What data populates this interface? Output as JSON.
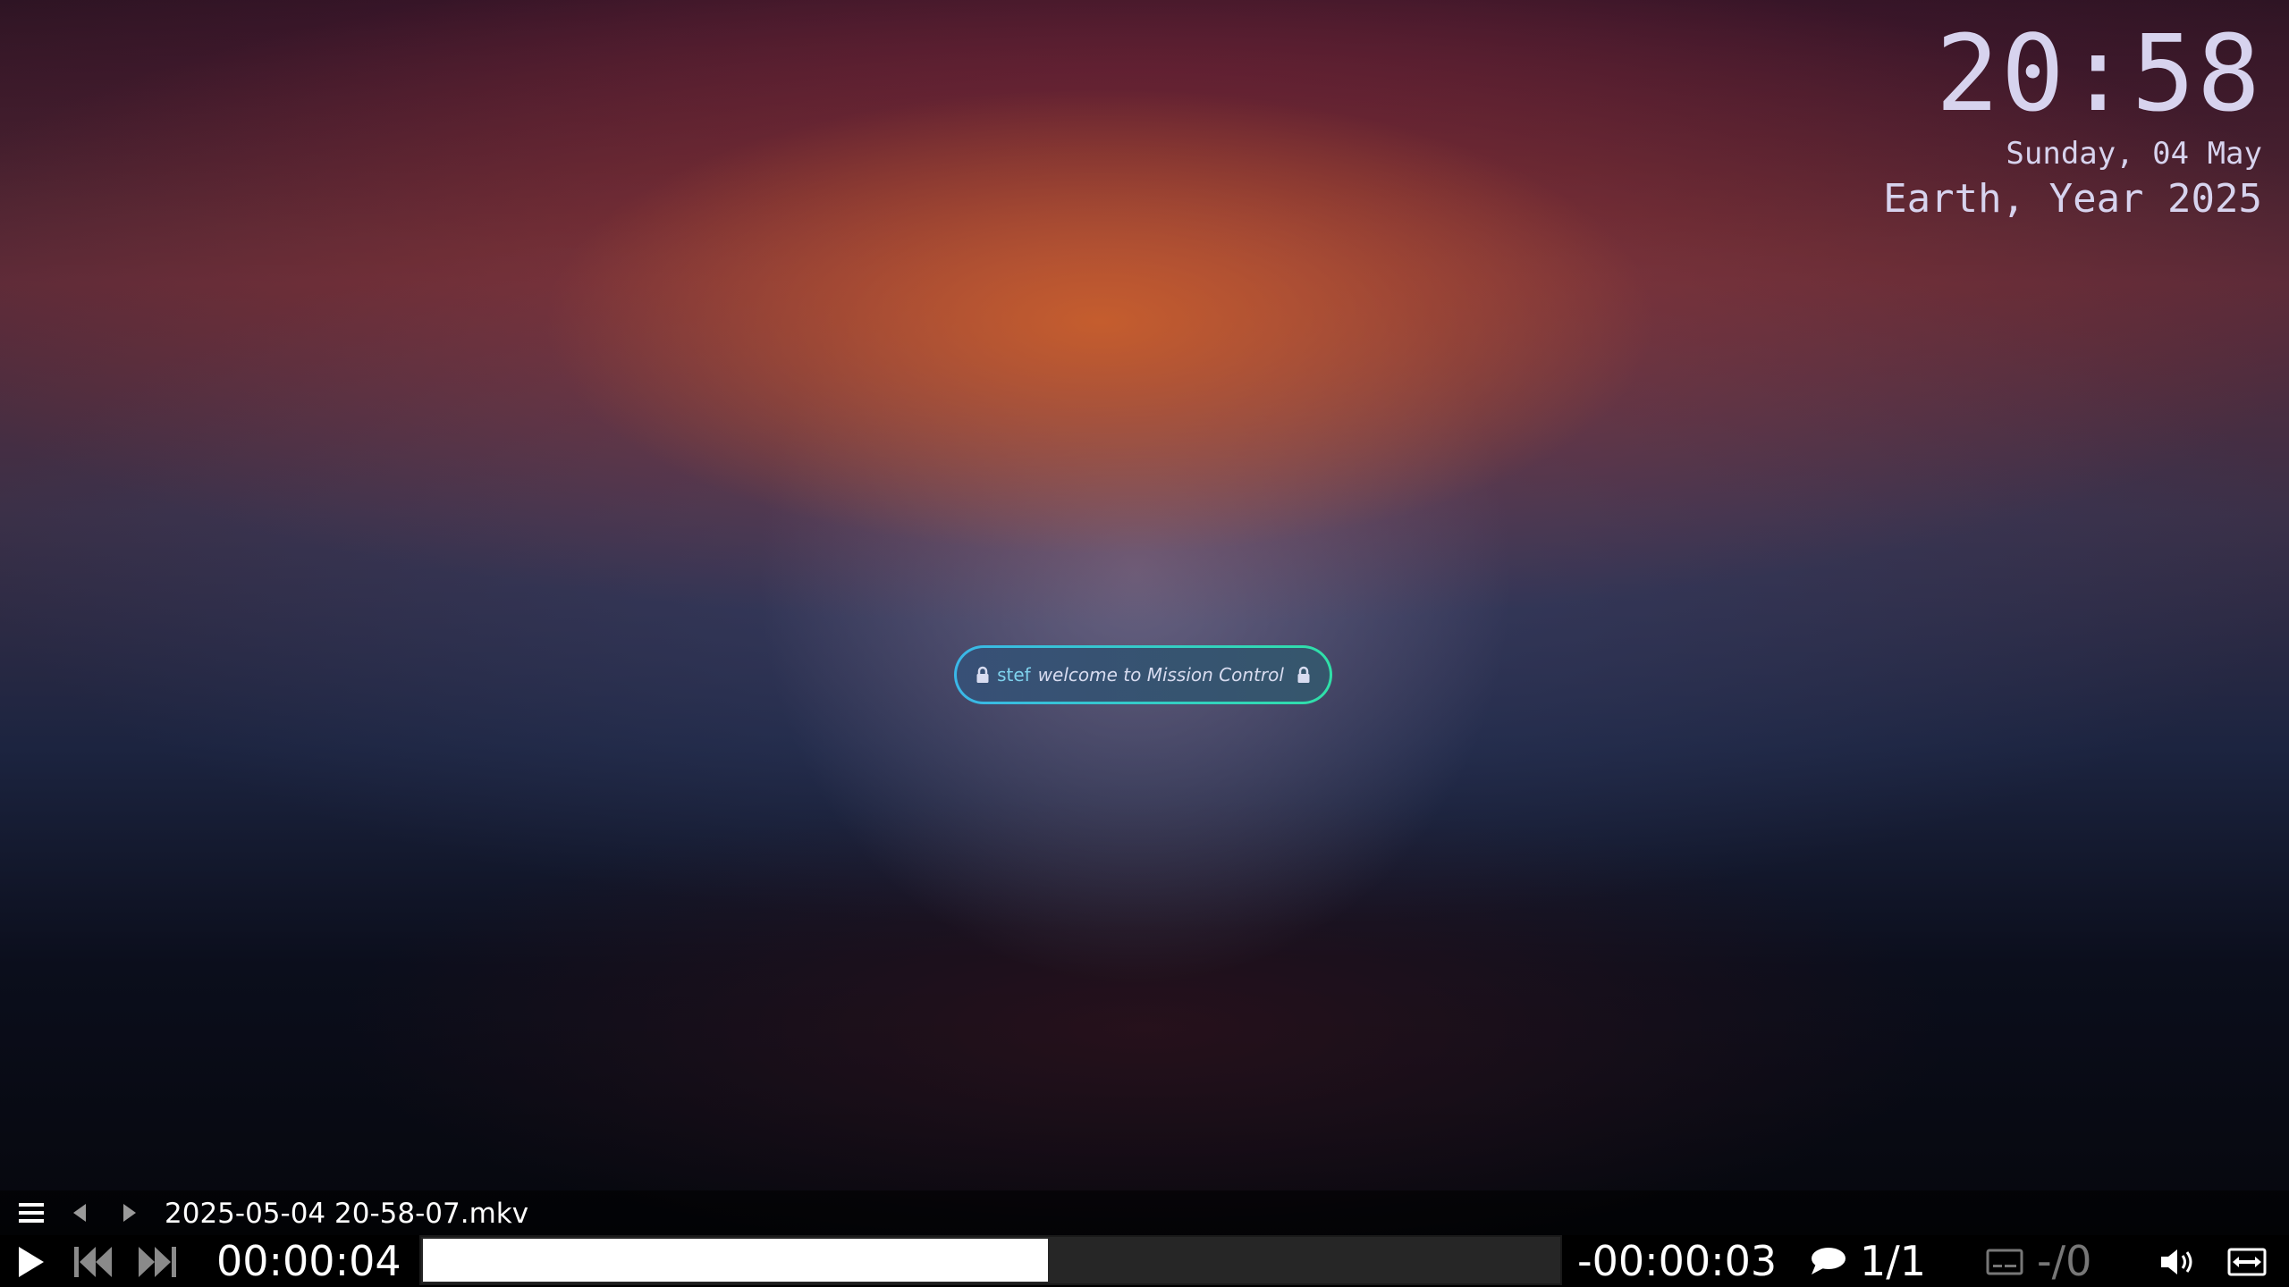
{
  "clock": {
    "time": "20:58",
    "date": "Sunday, 04 May",
    "planet_year": "Earth, Year 2025"
  },
  "greeter": {
    "user": "stef",
    "message": "welcome to Mission Control"
  },
  "player": {
    "filename": "2025-05-04 20-58-07.mkv",
    "elapsed": "00:00:04",
    "remaining": "-00:00:03",
    "progress_percent": 55,
    "audio_track": "1/1",
    "subtitle_track": "-/0"
  },
  "icons": {
    "playlist": "menu-icon",
    "prev_file": "triangle-left-icon",
    "next_file": "triangle-right-icon",
    "play": "play-icon",
    "skip_back": "skip-back-icon",
    "skip_forward": "skip-forward-icon",
    "audio": "speech-bubble-icon",
    "subtitles": "subtitle-icon",
    "volume": "speaker-icon",
    "fullscreen": "fullscreen-icon"
  },
  "colors": {
    "greeter_border_start": "#3ab7e8",
    "greeter_border_end": "#2fe0a8",
    "clock_text": "#d7d3ee",
    "seek_fill": "#ffffff"
  }
}
